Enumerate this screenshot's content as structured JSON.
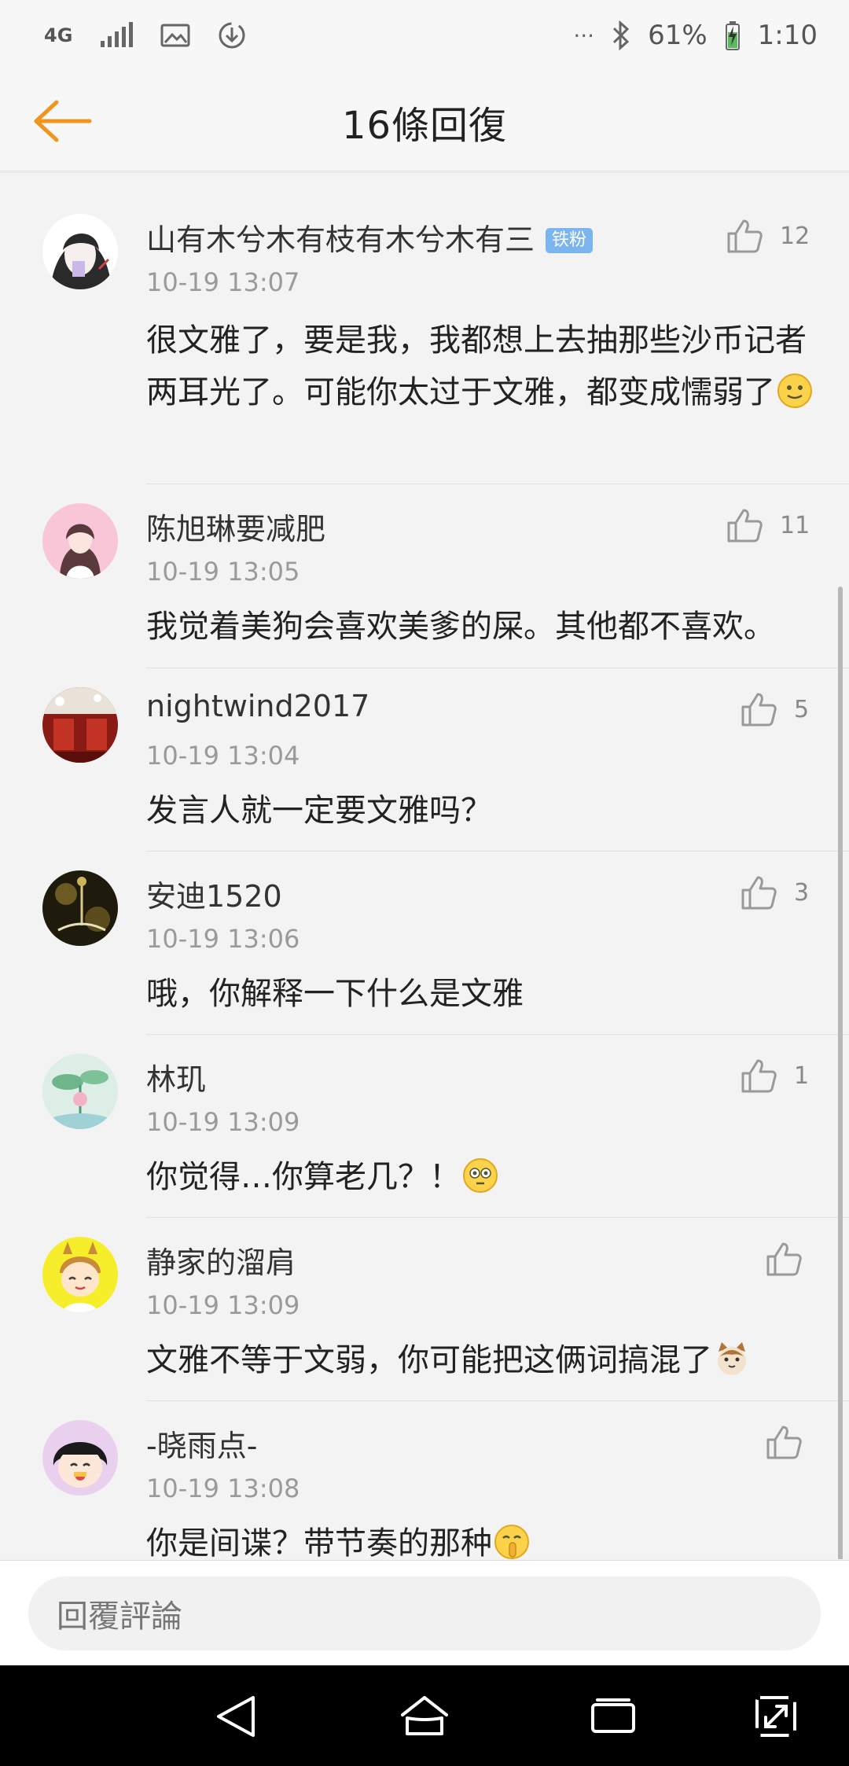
{
  "status_bar": {
    "network_label": "4G",
    "battery_percent": "61%",
    "time": "1:10",
    "overflow_dots": "···"
  },
  "header": {
    "title": "16條回復"
  },
  "comments": [
    {
      "username": "山有木兮木有枝有木兮木有三",
      "badge": "铁粉",
      "time": "10-19 13:07",
      "likes": "12",
      "text": "很文雅了，要是我，我都想上去抽那些沙币记者两耳光了。可能你太过于文雅，都变成懦弱了",
      "emoji": "slight-smile-emoji"
    },
    {
      "username": "陈旭琳要减肥",
      "time": "10-19 13:05",
      "likes": "11",
      "text": "我觉着美狗会喜欢美爹的屎。其他都不喜欢。"
    },
    {
      "username": "nightwind2017",
      "time": "10-19 13:04",
      "likes": "5",
      "text": "发言人就一定要文雅吗？"
    },
    {
      "username": "安迪1520",
      "time": "10-19 13:06",
      "likes": "3",
      "text": "哦，你解释一下什么是文雅"
    },
    {
      "username": "林玑",
      "time": "10-19 13:09",
      "likes": "1",
      "text": "你觉得…你算老几？！",
      "emoji": "flushed-emoji"
    },
    {
      "username": "静家的溜肩",
      "time": "10-19 13:09",
      "likes": "",
      "text": "文雅不等于文弱，你可能把这俩词搞混了",
      "emoji": "cat-emoji"
    },
    {
      "username": "-晓雨点-",
      "time": "10-19 13:08",
      "likes": "",
      "text": "你是间谍？带节奏的那种",
      "emoji": "shush-emoji"
    }
  ],
  "reply_bar": {
    "placeholder": "回覆評論"
  },
  "colors": {
    "accent": "#f0961e",
    "badge": "#7ab5f0",
    "background": "#f3f3f3"
  }
}
